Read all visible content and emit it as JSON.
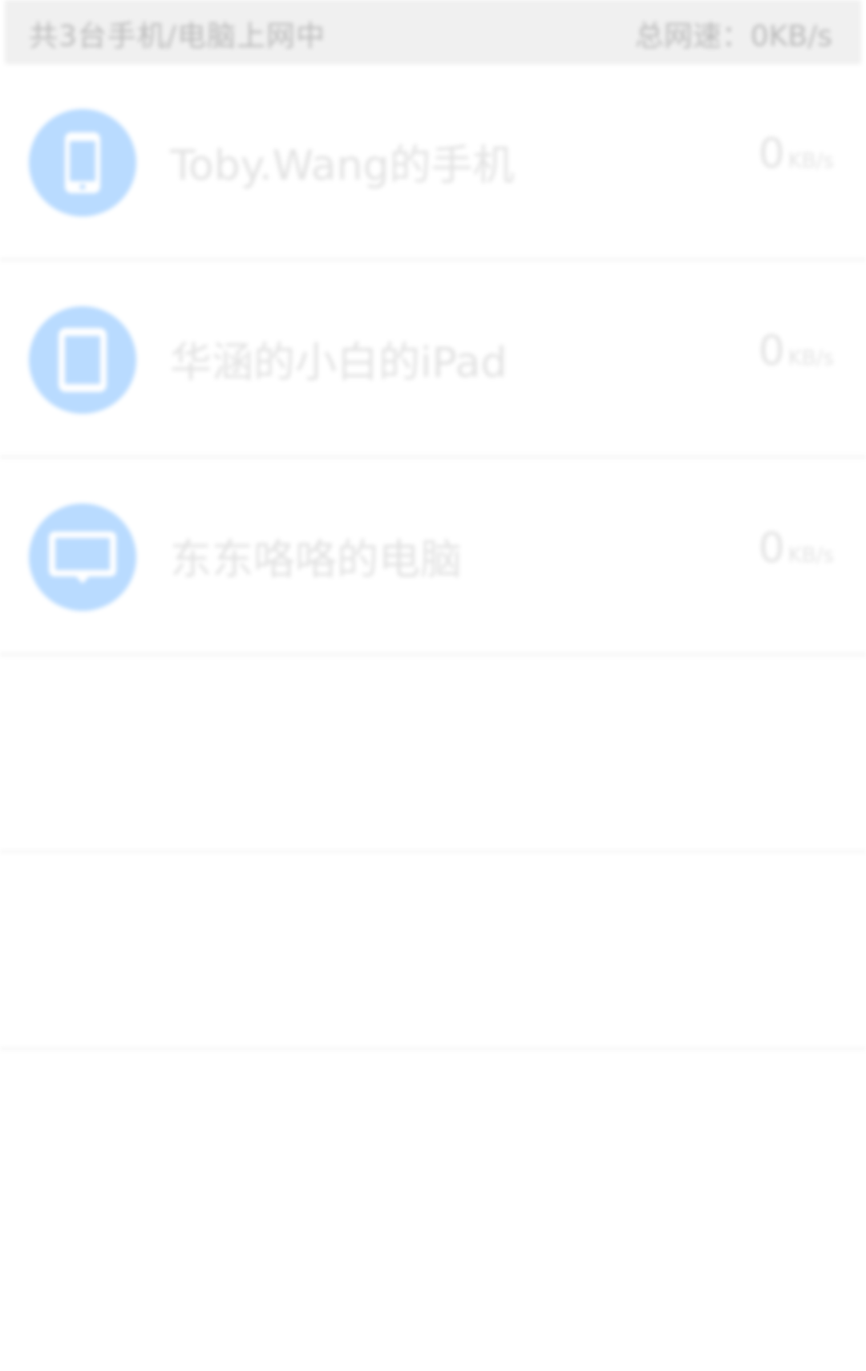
{
  "summary": {
    "online_text": "共3台手机/电脑上网中",
    "total_speed_text": "总网速：0KB/s"
  },
  "colors": {
    "summary_background": "#f0f0f0",
    "avatar": "#b9dbff",
    "name_text": "#e2e2e2",
    "speed_text": "#e3e3e3"
  },
  "devices": [
    {
      "icon": "phone-icon",
      "name": "Toby.Wang的手机",
      "speed": "0",
      "unit": "KB/s"
    },
    {
      "icon": "tablet-icon",
      "name": "华涵的小白的iPad",
      "speed": "0",
      "unit": "KB/s"
    },
    {
      "icon": "computer-icon",
      "name": "东东咯咯的电脑",
      "speed": "0",
      "unit": "KB/s"
    }
  ]
}
